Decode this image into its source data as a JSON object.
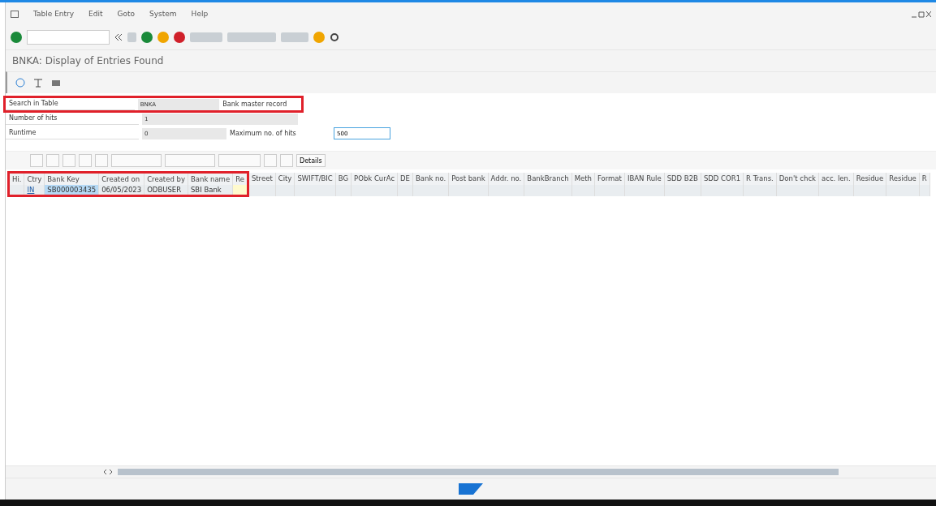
{
  "menu": [
    "Table Entry",
    "Edit",
    "Goto",
    "System",
    "Help"
  ],
  "title": "BNKA: Display of Entries Found",
  "form": [
    {
      "label": "Search in Table",
      "value": "BNKA",
      "description": "Bank master record",
      "highlighted": true
    },
    {
      "label": "Number of hits",
      "value": "1",
      "highlighted": false
    },
    {
      "label": "Runtime",
      "value": "0",
      "extra_label": "Maximum no. of hits",
      "extra_value": "500",
      "highlighted": false
    }
  ],
  "grid_toolbar": {
    "details_button": "Details"
  },
  "table": {
    "highlighted": true,
    "columns": [
      "Hi.",
      "Ctry",
      "Bank Key",
      "Created on",
      "Created by",
      "Bank name",
      "Re",
      "Street",
      "City",
      "SWIFT/BIC",
      "BG",
      "PObk CurAc",
      "DE",
      "Bank no.",
      "Post bank",
      "Addr. no.",
      "BankBranch",
      "Meth",
      "Format",
      "IBAN Rule",
      "SDD B2B",
      "SDD COR1",
      "R Trans.",
      "Don't chck",
      "acc. len.",
      "Residue",
      "Residue",
      "R"
    ],
    "rows": [
      {
        "cells": [
          {
            "text": "",
            "kind": "plain"
          },
          {
            "text": "IN",
            "kind": "link"
          },
          {
            "text": "SB000003435",
            "kind": "selected"
          },
          {
            "text": "06/05/2023",
            "kind": "plain"
          },
          {
            "text": "ODBUSER",
            "kind": "plain"
          },
          {
            "text": "SBI Bank",
            "kind": "plain"
          },
          {
            "text": "",
            "kind": "input"
          }
        ]
      }
    ]
  }
}
